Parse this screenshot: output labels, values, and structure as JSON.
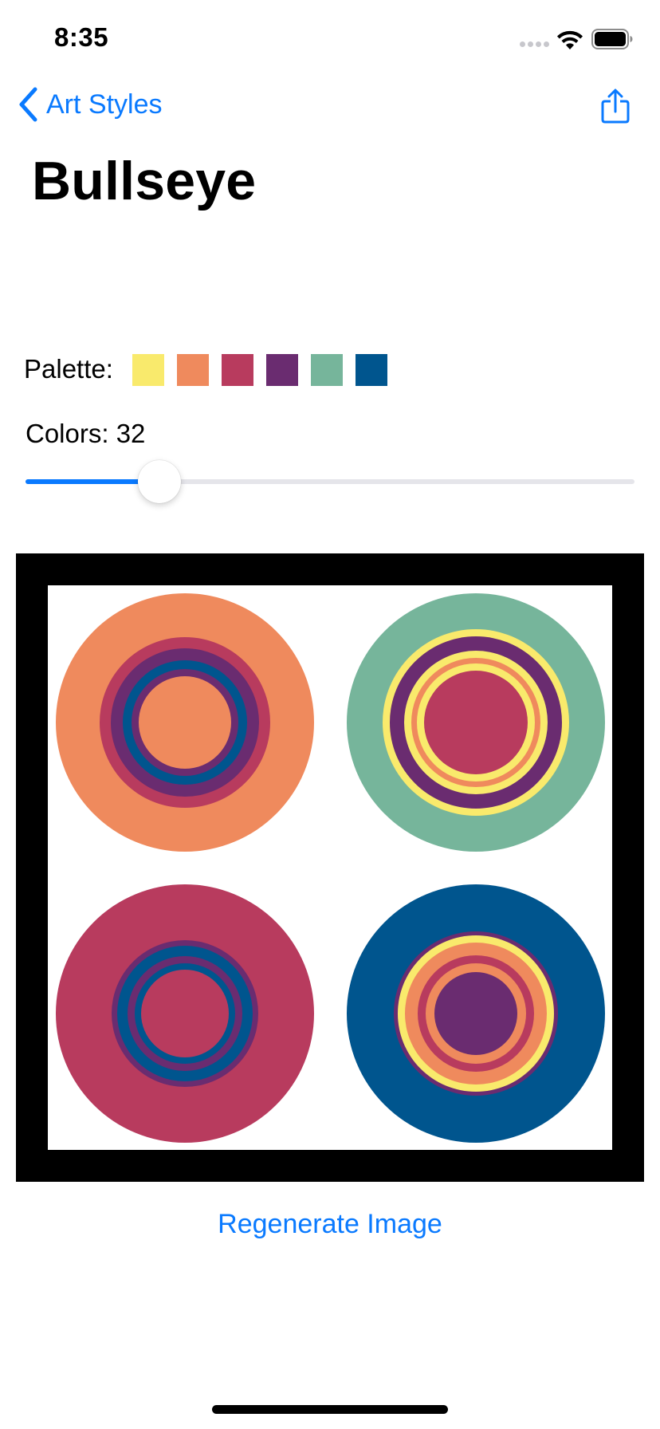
{
  "status_bar": {
    "time": "8:35"
  },
  "nav": {
    "back_label": "Art Styles",
    "title": "Bullseye"
  },
  "palette": {
    "label": "Palette:",
    "colors": [
      "#f9ea6c",
      "#ef8a5d",
      "#b83b5e",
      "#6a2c70",
      "#76b59b",
      "#00558e"
    ]
  },
  "colors_control": {
    "label": "Colors: 32",
    "value": 32,
    "fill_fraction": 0.22
  },
  "artwork": {
    "background": "#ffffff",
    "frame_color": "#000000",
    "bullseyes": [
      {
        "rings": [
          "#ef8a5d",
          "#b83b5e",
          "#6a2c70",
          "#00558e",
          "#6a2c70",
          "#ef8a5d"
        ]
      },
      {
        "rings": [
          "#76b59b",
          "#f9ea6c",
          "#6a2c70",
          "#f9ea6c",
          "#ef8a5d",
          "#f9ea6c",
          "#b83b5e"
        ]
      },
      {
        "rings": [
          "#b83b5e",
          "#6a2c70",
          "#00558e",
          "#6a2c70",
          "#00558e",
          "#b83b5e"
        ]
      },
      {
        "rings": [
          "#00558e",
          "#6a2c70",
          "#f9ea6c",
          "#ef8a5d",
          "#b83b5e",
          "#ef8a5d",
          "#6a2c70"
        ]
      }
    ]
  },
  "actions": {
    "regenerate_label": "Regenerate Image"
  },
  "theme": {
    "accent": "#0a7aff",
    "track": "#e5e5ea"
  }
}
